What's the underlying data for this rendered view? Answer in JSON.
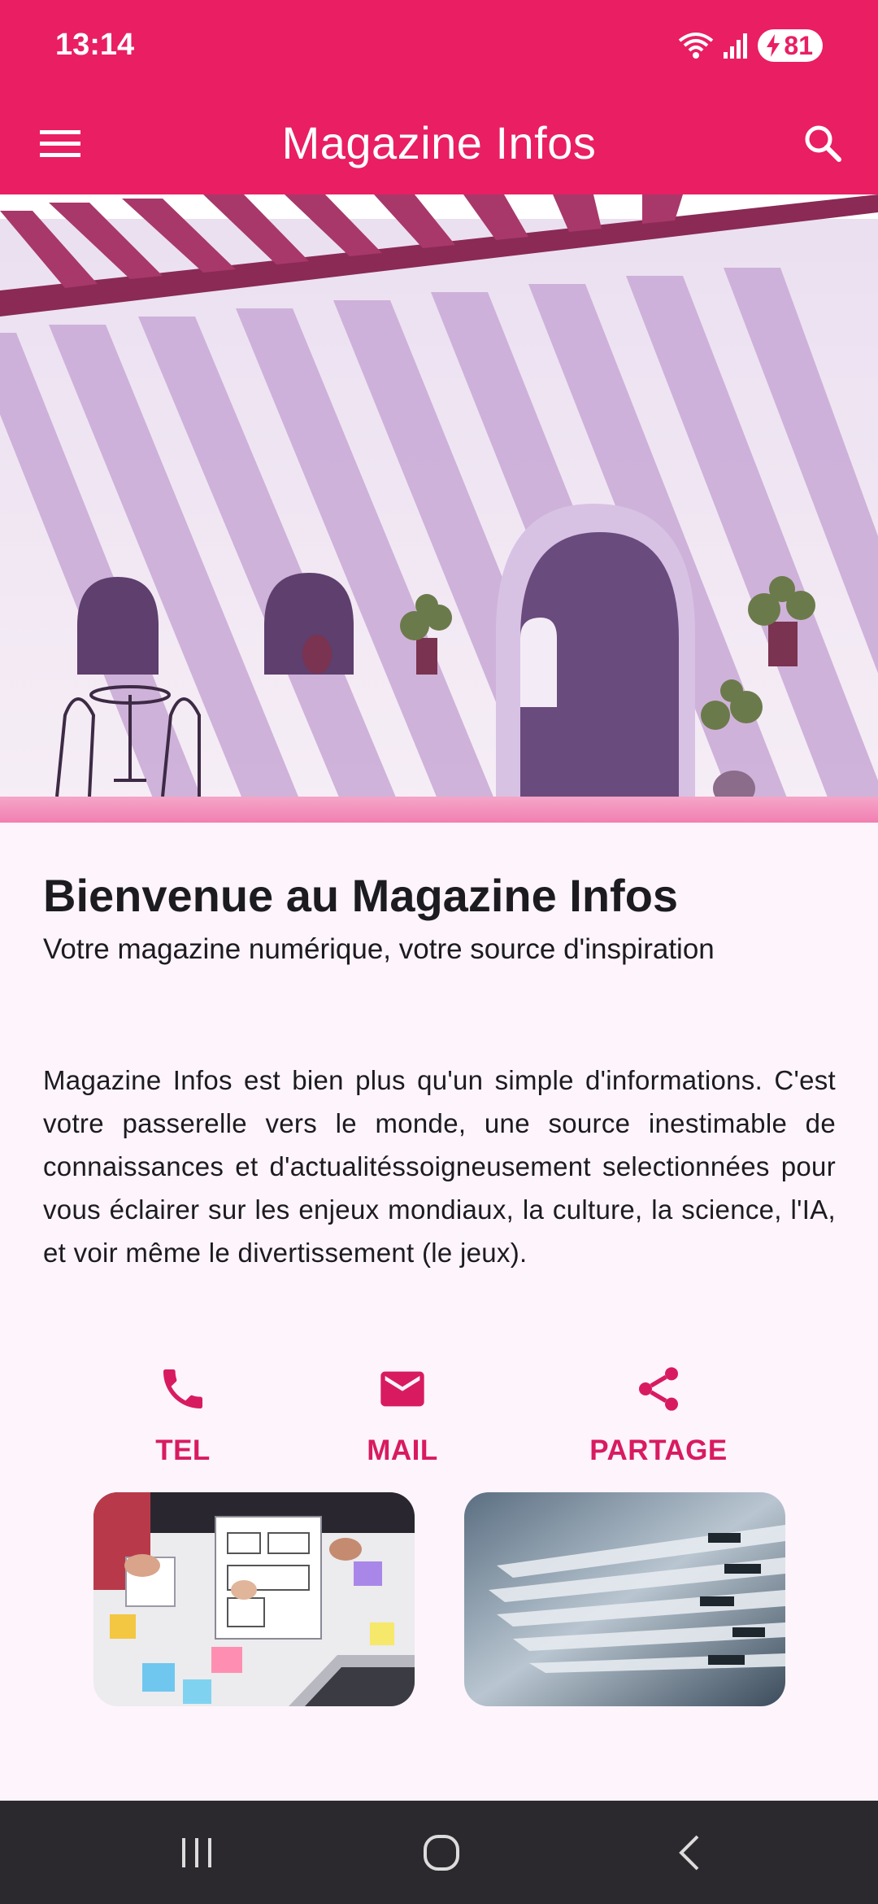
{
  "status_bar": {
    "time": "13:14",
    "battery_level": "81",
    "icons": [
      "wifi-icon",
      "signal-icon",
      "battery-charging-icon"
    ]
  },
  "app_bar": {
    "title": "Magazine Infos",
    "menu_icon": "menu-icon",
    "search_icon": "search-icon",
    "background_color": "#e91e63"
  },
  "content": {
    "headline": "Bienvenue au Magazine Infos",
    "subtitle": "Votre magazine numérique, votre source d'inspiration",
    "body": "Magazine Infos est bien plus qu'un simple d'informations. C'est votre passerelle vers le monde, une source inestimable de connaissances et d'actualitéssoigneusement selectionnées pour vous éclairer sur les enjeux mondiaux, la culture, la science, l'IA, et voir même le divertissement (le jeux)."
  },
  "actions": [
    {
      "label": "TEL",
      "icon": "phone-icon"
    },
    {
      "label": "MAIL",
      "icon": "mail-icon"
    },
    {
      "label": "PARTAGE",
      "icon": "share-icon"
    }
  ],
  "accent_color": "#d81b60",
  "nav_bar": {
    "buttons": [
      "recents-icon",
      "home-icon",
      "back-icon"
    ]
  }
}
